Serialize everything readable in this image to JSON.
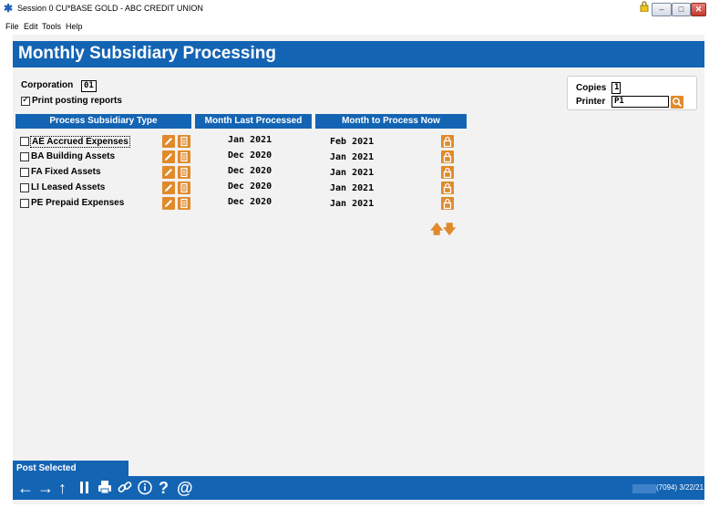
{
  "window": {
    "title": "Session 0 CU*BASE GOLD - ABC CREDIT UNION",
    "controls": {
      "minimize": "–",
      "maximize": "□",
      "close": "✕"
    }
  },
  "menu": [
    "File",
    "Edit",
    "Tools",
    "Help"
  ],
  "page": {
    "title": "Monthly Subsidiary Processing"
  },
  "corporation": {
    "label": "Corporation",
    "value": "01"
  },
  "print_posting": {
    "label": "Print posting reports",
    "checked": true
  },
  "printer_panel": {
    "copies_label": "Copies",
    "copies_value": "1",
    "printer_label": "Printer",
    "printer_value": "P1"
  },
  "columns": [
    "Process Subsidiary Type",
    "Month Last Processed",
    "Month to Process Now"
  ],
  "rows": [
    {
      "type": "AE Accrued Expenses",
      "last": "Jan 2021",
      "now": "Feb 2021",
      "checked": false
    },
    {
      "type": "BA Building Assets",
      "last": "Dec 2020",
      "now": "Jan 2021",
      "checked": false
    },
    {
      "type": "FA Fixed Assets",
      "last": "Dec 2020",
      "now": "Jan 2021",
      "checked": false
    },
    {
      "type": "LI Leased Assets",
      "last": "Dec 2020",
      "now": "Jan 2021",
      "checked": false
    },
    {
      "type": "PE Prepaid Expenses",
      "last": "Dec 2020",
      "now": "Jan 2021",
      "checked": false
    }
  ],
  "action": {
    "post_selected": "Post Selected"
  },
  "toolbar": {
    "back": "←",
    "forward": "→",
    "up": "↑",
    "pause": "⏸",
    "print": "🖶",
    "link": "🔗",
    "info": "ⓘ",
    "help": "?",
    "at": "@"
  },
  "status": {
    "code": "(7094) 3/22/21"
  },
  "colors": {
    "brand_blue": "#1464b4",
    "accent_orange": "#e08a2c",
    "background": "#f2f2f2"
  }
}
